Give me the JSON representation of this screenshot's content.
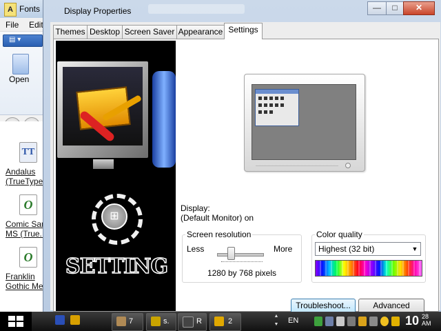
{
  "background_window": {
    "title": "Fonts",
    "menu": [
      "File",
      "Edit"
    ],
    "open_label": "Open",
    "fonts": [
      {
        "line1": "Andalus",
        "line2": "(TrueType"
      },
      {
        "line1": "Comic Sans",
        "line2": "MS (True..."
      },
      {
        "line1": "Franklin",
        "line2": "Gothic Me..."
      }
    ]
  },
  "dialog": {
    "title": "Display Properties",
    "window_buttons": {
      "minimize": "—",
      "maximize": "□",
      "close": "✕"
    },
    "tabs": [
      "Themes",
      "Desktop",
      "Screen Saver",
      "Appearance",
      "Settings"
    ],
    "active_tab": "Settings",
    "wallpaper_text": "SETTING",
    "display_label": "Display:",
    "display_value": "(Default Monitor) on",
    "resolution": {
      "group_label": "Screen resolution",
      "less": "Less",
      "more": "More",
      "value": "1280 by 768 pixels",
      "slider_fraction": 0.3
    },
    "color_quality": {
      "group_label": "Color quality",
      "selected": "Highest (32 bit)"
    },
    "buttons": {
      "troubleshoot": "Troubleshoot...",
      "advanced": "Advanced"
    }
  },
  "taskbar": {
    "items": [
      {
        "label": "7",
        "icon": "tool-icon"
      },
      {
        "label": "s.",
        "icon": "app-icon"
      },
      {
        "label": "R",
        "icon": "media-icon"
      },
      {
        "label": "2",
        "icon": "pen-icon"
      }
    ],
    "language": "EN",
    "clock": {
      "time": "10",
      "minutes": "28",
      "period": "AM"
    }
  },
  "colors": {
    "titlebar": "#bcd0e6",
    "taskbar": "#111111",
    "accent_button": "#bee6fd"
  }
}
